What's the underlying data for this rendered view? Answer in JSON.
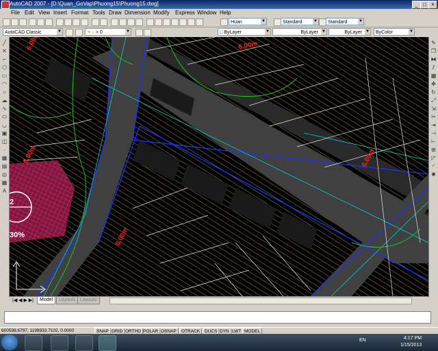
{
  "window": {
    "title": "AutoCAD 2007 - [D:\\Quan_GoVap\\Phuong15\\Phuong15.dwg]",
    "controls": [
      "_",
      "□",
      "×"
    ]
  },
  "menu": [
    "File",
    "Edit",
    "View",
    "Insert",
    "Format",
    "Tools",
    "Draw",
    "Dimension",
    "Modify",
    "Express",
    "Window",
    "Help"
  ],
  "toolbar": {
    "text_style": "Huan",
    "dim_style": "Standard",
    "table_style": "Standard",
    "workspace": "AutoCAD Classic",
    "layer": "0",
    "color": "ByLayer",
    "linetype": "ByLayer",
    "lineweight": "ByLayer",
    "plot_style": "ByColor"
  },
  "drawing": {
    "labels": [
      "6.00m",
      "6.00m",
      "6.00m",
      "6.00m",
      "6.00m"
    ],
    "percent": "30%",
    "number": "2"
  },
  "tabs": [
    "Model",
    "Layout1",
    "Layout2"
  ],
  "status": {
    "coords": "600598.6797, 1199933.7102, 0.0000",
    "buttons": [
      "SNAP",
      "GRID",
      "ORTHO",
      "POLAR",
      "OSNAP",
      "OTRACK",
      "DUCS",
      "DYN",
      "LWT",
      "MODEL"
    ]
  },
  "taskbar": {
    "language": "EN",
    "time": "4:17 PM",
    "date": "1/15/2013"
  },
  "colors": {
    "background": "#000000",
    "hatch": "#c8b45a",
    "road": "#404040",
    "building": "#2a2a2a",
    "blue": "#2030ff",
    "green": "#20c020",
    "cyan": "#00d0d0",
    "red": "#ff2020",
    "magenta": "#c0205a"
  }
}
